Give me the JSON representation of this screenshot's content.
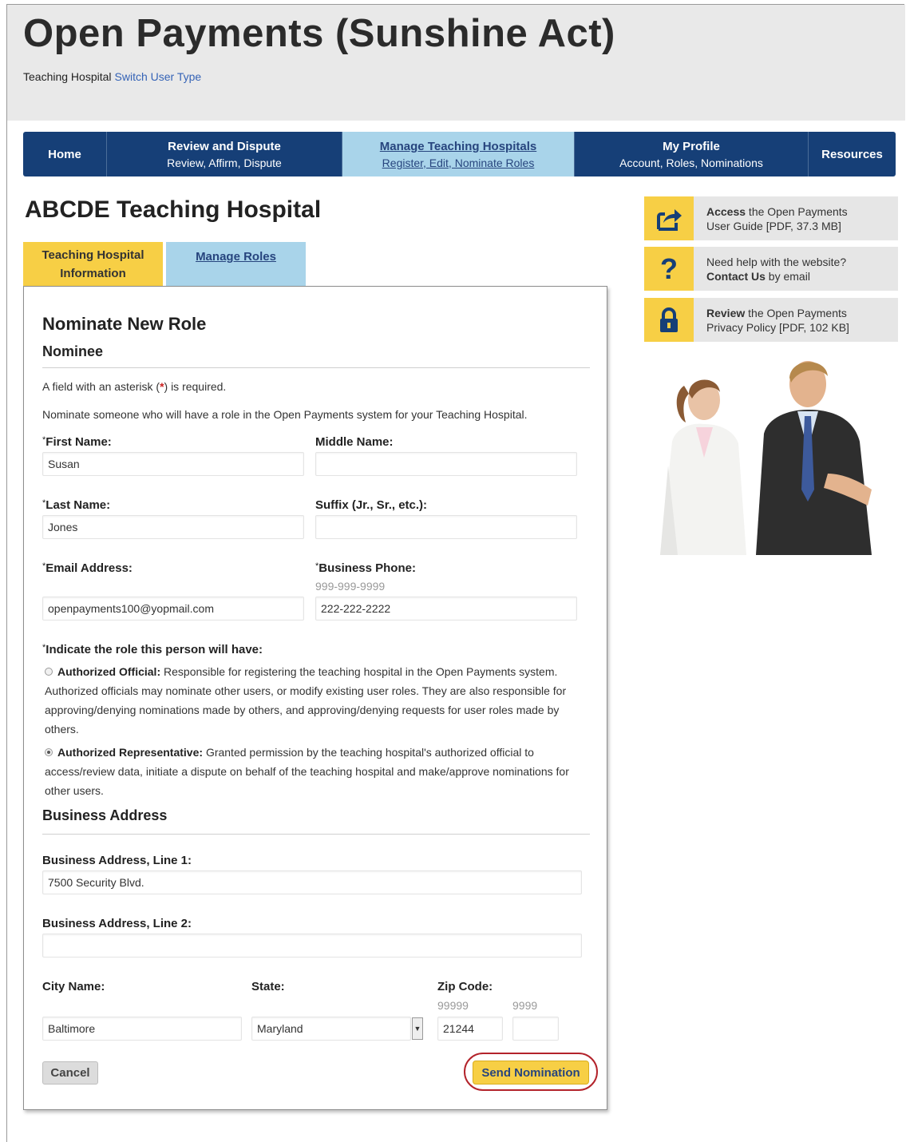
{
  "header": {
    "title": "Open Payments (Sunshine Act)",
    "user_type": "Teaching Hospital",
    "switch_link": "Switch User Type"
  },
  "nav": [
    {
      "title": "Home",
      "sub": ""
    },
    {
      "title": "Review and Dispute",
      "sub": "Review, Affirm, Dispute"
    },
    {
      "title": "Manage Teaching Hospitals",
      "sub": "Register, Edit, Nominate Roles"
    },
    {
      "title": "My Profile",
      "sub": "Account, Roles, Nominations"
    },
    {
      "title": "Resources",
      "sub": ""
    }
  ],
  "hospital_name": "ABCDE Teaching Hospital",
  "tabs": {
    "info_line1": "Teaching Hospital",
    "info_line2": "Information",
    "roles": "Manage Roles"
  },
  "form": {
    "title": "Nominate New Role",
    "nominee_heading": "Nominee",
    "required_pre": "A field with an asterisk (",
    "required_star": "*",
    "required_post": ") is required.",
    "intro": "Nominate someone who will have a role in the Open Payments system for your Teaching Hospital.",
    "first_name_label": "First Name:",
    "first_name_value": "Susan",
    "middle_name_label": "Middle Name:",
    "middle_name_value": "",
    "last_name_label": "Last Name:",
    "last_name_value": "Jones",
    "suffix_label": "Suffix (Jr., Sr., etc.):",
    "suffix_value": "",
    "email_label": "Email Address:",
    "email_value": "openpayments100@yopmail.com",
    "phone_label": "Business Phone:",
    "phone_hint": "999-999-9999",
    "phone_value": "222-222-2222",
    "role_question": "Indicate the role this person will have:",
    "role_official_title": "Authorized Official:",
    "role_official_desc": "Responsible for registering the teaching hospital in the Open Payments system. Authorized officials may nominate other users, or modify existing user roles. They are also responsible for approving/denying nominations made by others, and approving/denying requests for user roles made by others.",
    "role_rep_title": "Authorized Representative:",
    "role_rep_desc": "Granted permission by the teaching hospital's authorized official to access/review data, initiate a dispute on behalf of the teaching hospital and make/approve nominations for other users.",
    "selected_role": "Authorized Representative",
    "address_heading": "Business Address",
    "addr1_label": "Business Address, Line 1:",
    "addr1_value": "7500 Security Blvd.",
    "addr2_label": "Business Address, Line 2:",
    "addr2_value": "",
    "city_label": "City Name:",
    "city_value": "Baltimore",
    "state_label": "State:",
    "state_value": "Maryland",
    "zip_label": "Zip Code:",
    "zip_hint": "99999",
    "zip4_hint": "9999",
    "zip_value": "21244",
    "zip4_value": "",
    "cancel": "Cancel",
    "send": "Send Nomination"
  },
  "sidebar": [
    {
      "bold": "Access",
      "rest": " the Open Payments",
      "line2": "User Guide [PDF, 37.3 MB]",
      "icon": "share-arrow-icon"
    },
    {
      "bold": "",
      "rest": "Need help with the website?",
      "line2_bold": "Contact Us",
      "line2": " by email",
      "icon": "question-icon"
    },
    {
      "bold": "Review",
      "rest": " the Open Payments",
      "line2": "Privacy Policy [PDF, 102 KB]",
      "icon": "lock-icon"
    }
  ],
  "colors": {
    "nav_bg": "#163f77",
    "nav_active": "#a9d4ea",
    "accent_yellow": "#f7cf45",
    "highlight_red": "#b3232b"
  }
}
